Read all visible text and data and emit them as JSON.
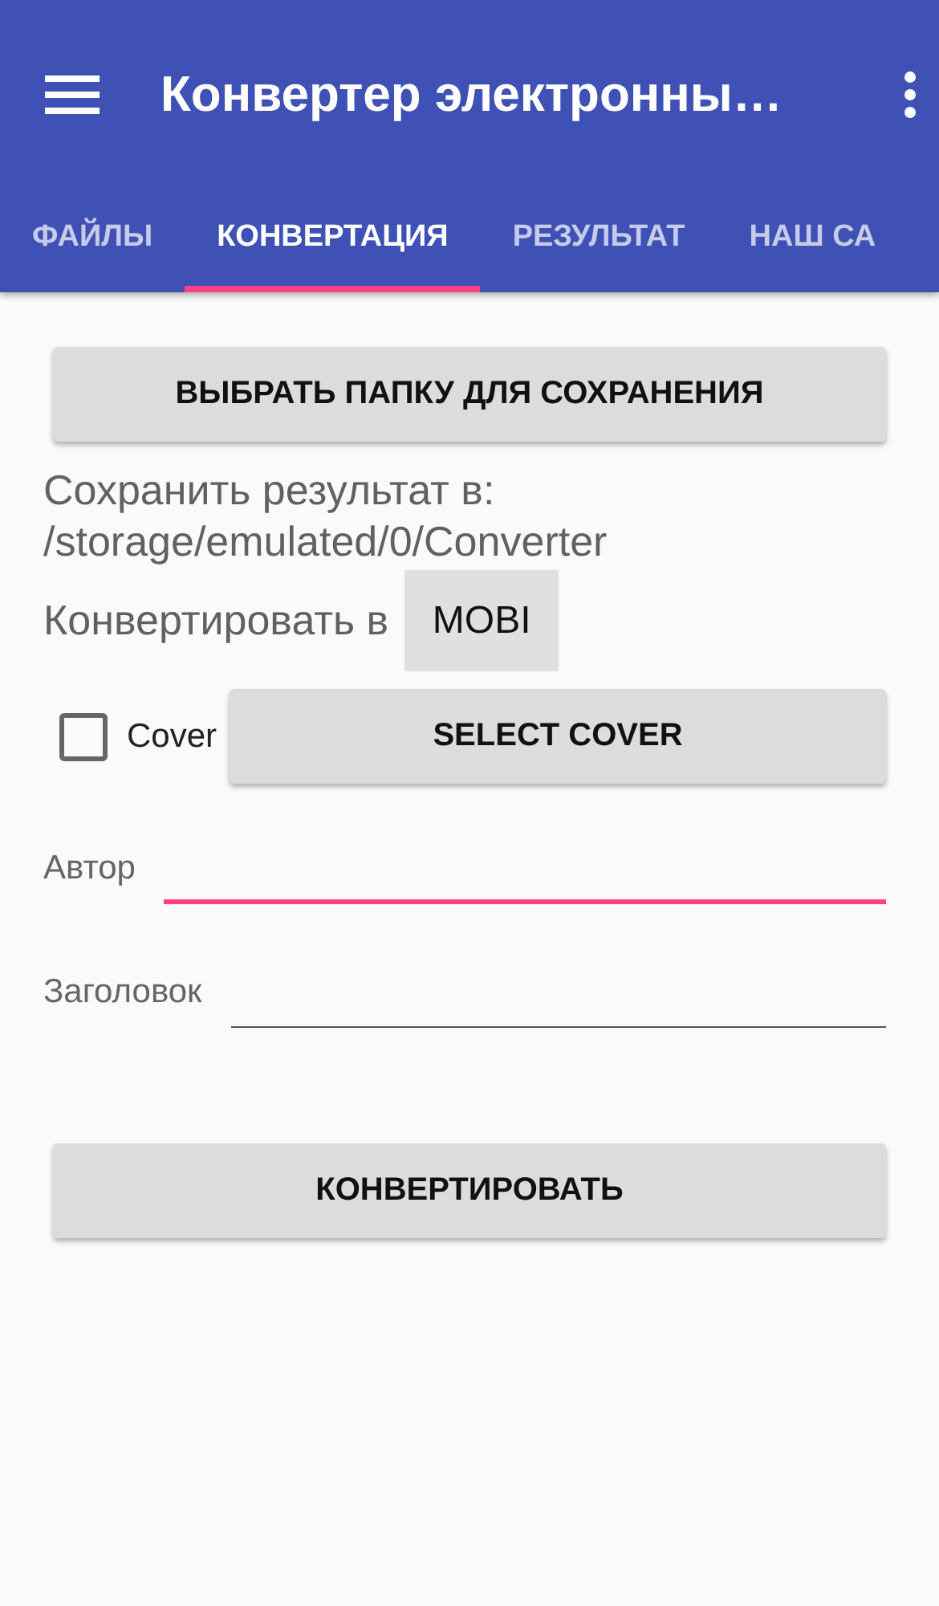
{
  "app_bar": {
    "title": "Конвертер электронны…"
  },
  "tabs": [
    {
      "label": "ФАЙЛЫ",
      "selected": false
    },
    {
      "label": "КОНВЕРТАЦИЯ",
      "selected": true
    },
    {
      "label": "РЕЗУЛЬТАТ",
      "selected": false
    },
    {
      "label": "НАШ СА",
      "selected": false
    }
  ],
  "folder_button": "ВЫБРАТЬ ПАПКУ ДЛЯ СОХРАНЕНИЯ",
  "save_path": "Сохранить результат в: /storage/emulated/0/Converter",
  "format": {
    "label": "Конвертировать в",
    "value": "MOBI"
  },
  "cover": {
    "label": "Cover",
    "checked": false,
    "button": "SELECT COVER"
  },
  "fields": [
    {
      "label": "Автор",
      "focused": true
    },
    {
      "label": "Заголовок",
      "focused": false
    }
  ],
  "convert_button": "КОНВЕРТИРОВАТЬ"
}
